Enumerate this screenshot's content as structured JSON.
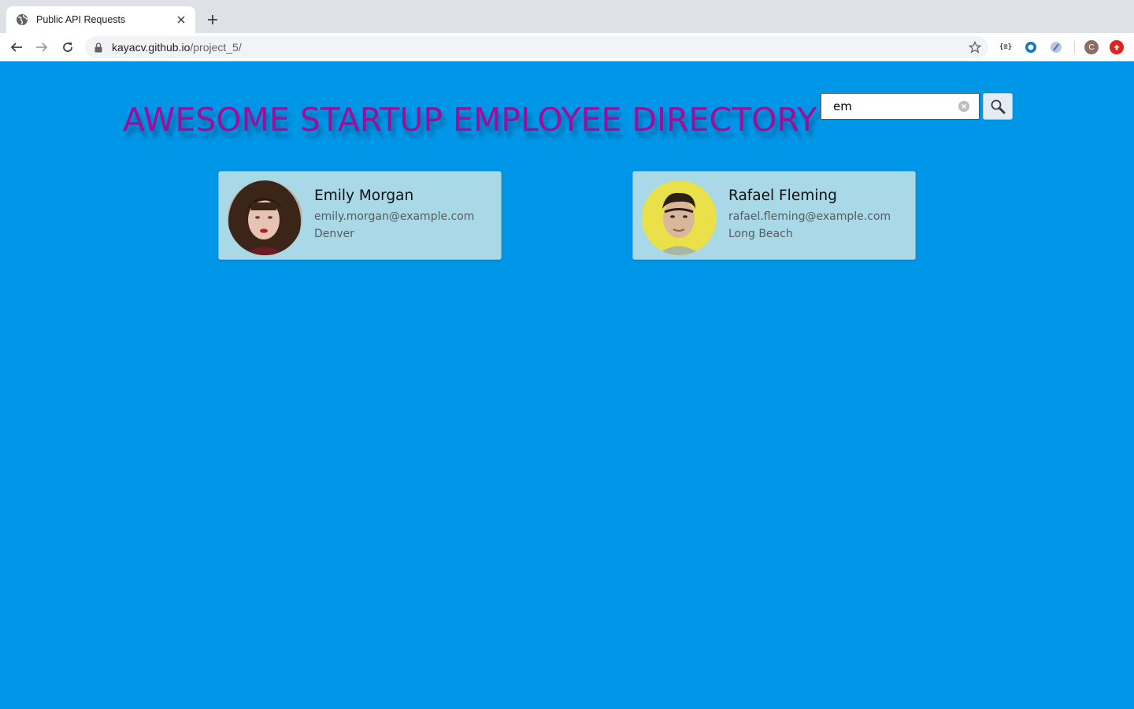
{
  "browser": {
    "tab_title": "Public API Requests",
    "url_host": "kayacv.github.io",
    "url_path": "/project_5/",
    "profile_initial": "C",
    "extension_json_label": "{≡}"
  },
  "page": {
    "title": "AWESOME STARTUP EMPLOYEE DIRECTORY",
    "title_color": "#a10c9a",
    "background_color": "#0096e8"
  },
  "search": {
    "value": "em",
    "placeholder": ""
  },
  "employees": [
    {
      "name": "Emily Morgan",
      "email": "emily.morgan@example.com",
      "city": "Denver"
    },
    {
      "name": "Rafael Fleming",
      "email": "rafael.fleming@example.com",
      "city": "Long Beach"
    }
  ]
}
